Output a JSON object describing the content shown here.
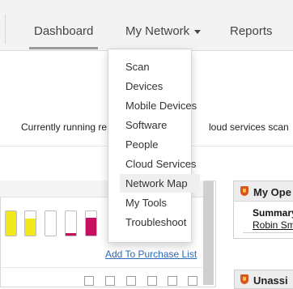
{
  "nav": {
    "dashboard": "Dashboard",
    "my_network": "My Network",
    "reports": "Reports"
  },
  "status": {
    "left_text": "Currently running re",
    "right_text": "loud services scan"
  },
  "dropdown": {
    "items": [
      "Scan",
      "Devices",
      "Mobile Devices",
      "Software",
      "People",
      "Cloud Services",
      "Network Map",
      "My Tools",
      "Troubleshoot"
    ],
    "highlighted_item": "Network Map"
  },
  "left_panel": {
    "purchase_link": "Add To Purchase List",
    "bars": [
      {
        "fill_fraction": 1.0,
        "color": "#f0e81c"
      },
      {
        "fill_fraction": 0.7,
        "color": "#f0e81c"
      },
      {
        "fill_fraction": 0.0,
        "color": "#ffffff"
      },
      {
        "fill_fraction": 0.1,
        "color": "#c4105d"
      },
      {
        "fill_fraction": 0.75,
        "color": "#c4105d"
      }
    ]
  },
  "right_panel": {
    "title": "My Ope",
    "summary_label": "Summary",
    "person_link": "Robin Sm",
    "second_title": "Unassi"
  },
  "colors": {
    "accent_link": "#2a6ab8",
    "yellow": "#f0e81c",
    "magenta": "#c4105d",
    "shield": "#d9541e"
  }
}
